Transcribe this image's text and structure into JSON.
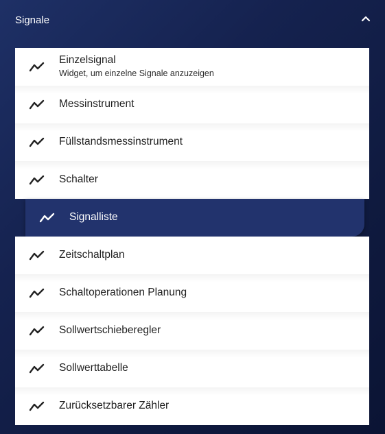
{
  "header": {
    "title": "Signale",
    "collapse_icon": "chevron-up-icon"
  },
  "items": [
    {
      "label": "Einzelsignal",
      "sublabel": "Widget, um einzelne Signale anzuzeigen",
      "icon": "trend-line-icon"
    },
    {
      "label": "Messinstrument",
      "icon": "trend-line-icon"
    },
    {
      "label": "Füllstandsmessinstrument",
      "icon": "trend-line-icon"
    },
    {
      "label": "Schalter",
      "icon": "trend-line-icon"
    },
    {
      "label": "Signalliste",
      "icon": "trend-line-icon",
      "selected": true
    },
    {
      "label": "Zeitschaltplan",
      "icon": "trend-line-icon"
    },
    {
      "label": "Schaltoperationen Planung",
      "icon": "trend-line-icon"
    },
    {
      "label": "Sollwertschieberegler",
      "icon": "trend-line-icon"
    },
    {
      "label": "Sollwerttabelle",
      "icon": "trend-line-icon"
    },
    {
      "label": "Zurücksetzbarer Zähler",
      "icon": "trend-line-icon"
    }
  ],
  "colors": {
    "background": "#15224f",
    "selected": "#22336d",
    "item_bg": "#ffffff",
    "item_text": "#1e1e1e",
    "selected_text": "#ffffff"
  }
}
